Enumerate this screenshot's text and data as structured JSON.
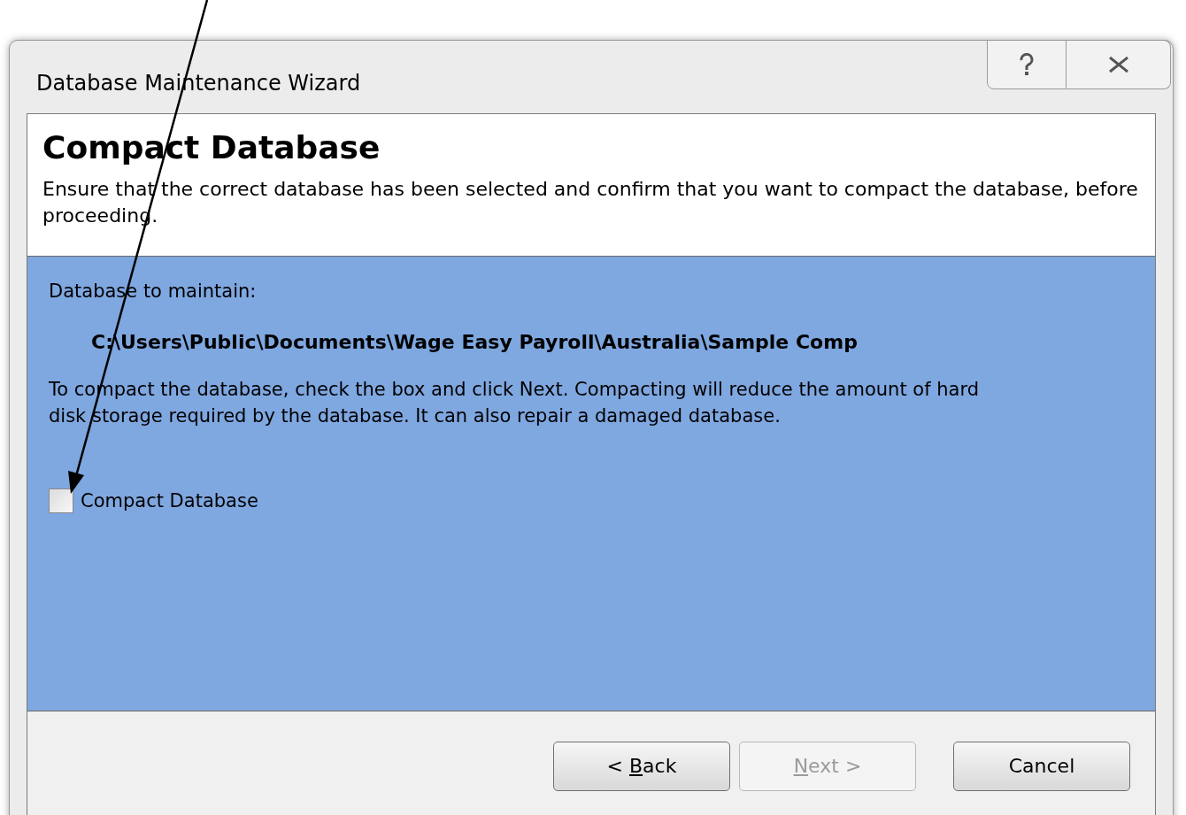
{
  "window": {
    "title": "Database Maintenance Wizard"
  },
  "header": {
    "title": "Compact Database",
    "description": "Ensure that the correct database has been selected and confirm that you want to compact the database, before proceeding."
  },
  "body": {
    "label": "Database to maintain:",
    "path": "C:\\Users\\Public\\Documents\\Wage Easy Payroll\\Australia\\Sample Comp",
    "instructions": "To compact the database, check the box and click Next. Compacting will reduce the amount of hard disk storage required by the database. It can also repair a damaged database.",
    "checkbox": {
      "label": "Compact Database",
      "checked": false
    }
  },
  "buttons": [
    {
      "before": "< ",
      "mnemonic": "B",
      "after": "ack",
      "disabled": false
    },
    {
      "mnemonic": "N",
      "after": "ext >",
      "disabled": true
    },
    {
      "before": "Cancel",
      "disabled": false
    }
  ]
}
